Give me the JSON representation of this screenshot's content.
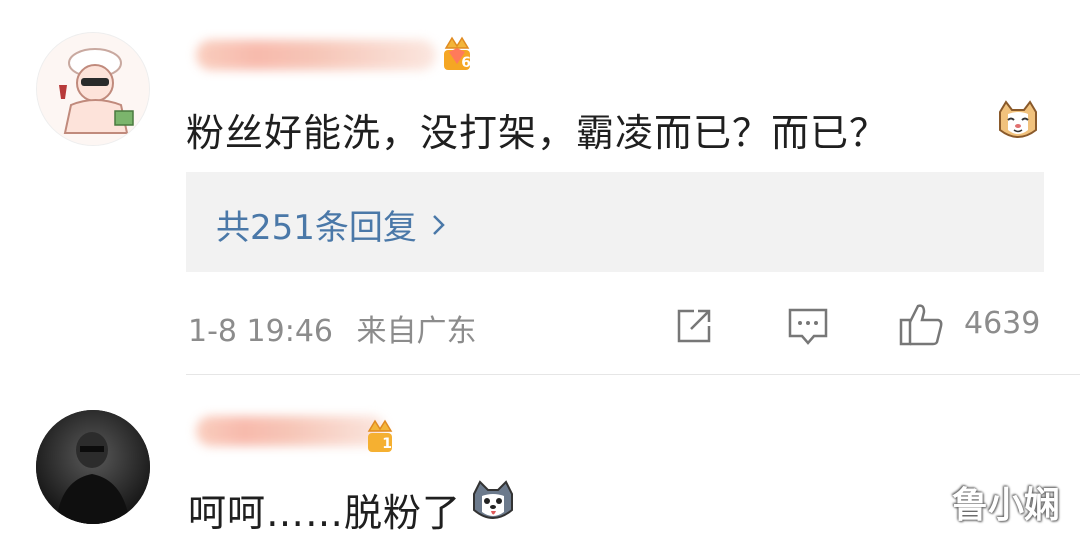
{
  "comments": [
    {
      "badge_level": "6",
      "text": "粉丝好能洗，没打架，霸凌而已？而已？",
      "emoji_icon": "cat-face-emoji-icon",
      "replies_label": "共251条回复",
      "timestamp": "1-8 19:46",
      "source": "来自广东",
      "likes": "4639"
    },
    {
      "badge_level": "1",
      "text": "呵呵……脱粉了",
      "emoji_icon": "husky-dog-emoji-icon"
    }
  ],
  "watermark": "鲁小娴",
  "colors": {
    "link": "#4a78a8",
    "meta": "#8c8c8c",
    "reply_bg": "#f2f2f2"
  }
}
